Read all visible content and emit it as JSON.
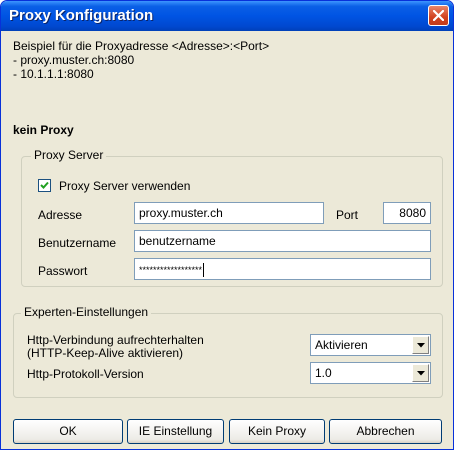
{
  "window": {
    "title": "Proxy Konfiguration"
  },
  "intro": {
    "line1": "Beispiel für die Proxyadresse <Adresse>:<Port>",
    "line2": "- proxy.muster.ch:8080",
    "line3": "- 10.1.1.1:8080"
  },
  "mode_label": "kein Proxy",
  "proxy_server": {
    "legend": "Proxy Server",
    "use_proxy_label": "Proxy Server verwenden",
    "use_proxy_checked": true,
    "address_label": "Adresse",
    "address_value": "proxy.muster.ch",
    "port_label": "Port",
    "port_value": "8080",
    "username_label": "Benutzername",
    "username_value": "benutzername",
    "password_label": "Passwort",
    "password_value": "******************"
  },
  "expert": {
    "legend": "Experten-Einstellungen",
    "keepalive_label_1": "Http-Verbindung aufrechterhalten",
    "keepalive_label_2": "(HTTP-Keep-Alive aktivieren)",
    "keepalive_value": "Aktivieren",
    "protocol_label": "Http-Protokoll-Version",
    "protocol_value": "1.0"
  },
  "buttons": {
    "ok": "OK",
    "ie_settings": "IE Einstellung",
    "no_proxy": "Kein Proxy",
    "cancel": "Abbrechen"
  },
  "colors": {
    "titlebar": "#0054e3",
    "close": "#d1421f",
    "dialog_bg": "#ece9d8"
  },
  "icons": {
    "close": "close-icon",
    "check": "checkmark-icon",
    "dropdown": "chevron-down-icon"
  }
}
